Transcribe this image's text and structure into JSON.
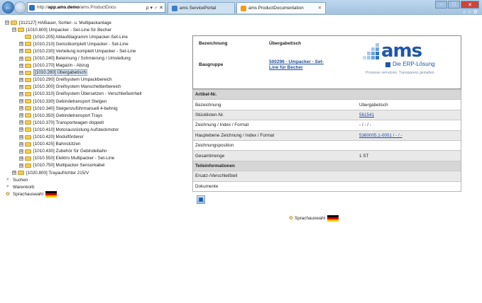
{
  "browser": {
    "address_prefix": "http://",
    "address_host": "app.ams.demo",
    "address_path": "/ams.ProductDocu",
    "address_controls": "ρ ▾ ♂ ✕",
    "tabs": [
      {
        "label": "ams ServicePortal"
      },
      {
        "label": "ams ProductDocumentation",
        "close": "✕"
      }
    ],
    "window_buttons": {
      "minimize": "–",
      "maximize": "□",
      "close": "✕"
    },
    "tool_icons": "⌂ ☆ ⚙"
  },
  "tree": {
    "nodes": [
      {
        "expander": "⊟",
        "label": "[312127] HABauer, Sortier- u. Multipackanlage",
        "indent": 0
      },
      {
        "expander": "⊟",
        "label": "[1010.800] Umpacker - Set-Line für Becher",
        "indent": 1
      },
      {
        "expander": "",
        "label": "[1010.205] Ablaufdiagramm Umpacker-Set-Line",
        "indent": 2
      },
      {
        "expander": "⊞",
        "label": "[1010.210] Gerüstkomplett Umpacker - Set-Line",
        "indent": 2
      },
      {
        "expander": "⊞",
        "label": "[1010.230] Verteilung komplett Umpacker - Set-Line",
        "indent": 2
      },
      {
        "expander": "⊞",
        "label": "[1010.240] Beleimung / Schmierung / Umstellung",
        "indent": 2
      },
      {
        "expander": "⊞",
        "label": "[1010.270] Magazin - Abzug",
        "indent": 2
      },
      {
        "expander": "⊞",
        "label": "[1010.280] Übergabetisch",
        "indent": 2,
        "selected": true
      },
      {
        "expander": "⊞",
        "label": "[1010.290] Greifsystem Umpackbereich",
        "indent": 2
      },
      {
        "expander": "⊞",
        "label": "[1010.300] Greifsystem Manschettierbereich",
        "indent": 2
      },
      {
        "expander": "⊞",
        "label": "[1010.310] Greifsystem Übersetzen - Verschließeinheit",
        "indent": 2
      },
      {
        "expander": "⊞",
        "label": "[1010.330] Gebindetransport Steigen",
        "indent": 2
      },
      {
        "expander": "⊞",
        "label": "[1010.340] Steigenzuführmanuell 4-behnig",
        "indent": 2
      },
      {
        "expander": "⊞",
        "label": "[1010.350] Gebindetransport Trays",
        "indent": 2
      },
      {
        "expander": "⊞",
        "label": "[1010.370] Transportwagen doppelt",
        "indent": 2
      },
      {
        "expander": "⊞",
        "label": "[1010.410] Motorausrüstung Aufsteckmotor",
        "indent": 2
      },
      {
        "expander": "⊞",
        "label": "[1010.420] Modulförderer",
        "indent": 2
      },
      {
        "expander": "⊞",
        "label": "[1010.425] Bahnstützen",
        "indent": 2
      },
      {
        "expander": "⊞",
        "label": "[1010.430] Zubehör für Gebindebahn",
        "indent": 2
      },
      {
        "expander": "⊞",
        "label": "[1010.550] Elektro Multipacker - Set-Line",
        "indent": 2
      },
      {
        "expander": "⊞",
        "label": "[1010.750] Multipacker Sensorkabel",
        "indent": 2
      },
      {
        "expander": "⊞",
        "label": "[1020.800] Trayaufrichter 215/V",
        "indent": 1
      }
    ],
    "search_label": "Suchen",
    "cart_label": "Warenkorb",
    "language_label": "Sprachauswahl"
  },
  "header": {
    "bezeichnung_label": "Bezeichnung",
    "bezeichnung_value": "Übergabetisch",
    "baugruppe_label": "Baugruppe",
    "baugruppe_value": "500296 - Umpacker - Set-Line für Becher"
  },
  "logo": {
    "word": "ams",
    "tagline": "Die ERP-Lösung",
    "slogan": "Prozesse vernetzen. Transparenz gestalten."
  },
  "table": {
    "rows": [
      {
        "label": "Artikel-Nr.",
        "value": "",
        "style": "head"
      },
      {
        "label": "Bezeichnung",
        "value": "Übergabetisch",
        "style": "plain"
      },
      {
        "label": "Stücklisten-Nr.",
        "value": "561541",
        "style": "gray",
        "link": true
      },
      {
        "label": "Zeichnung / Index / Format",
        "value": "- / - / -",
        "style": "plain"
      },
      {
        "label": "Hauptebene Zeichnung / Index / Format",
        "value": "5360005.1-0001 / - / -",
        "style": "gray",
        "link": true
      },
      {
        "label": "Zeichnungsposition",
        "value": "",
        "style": "plain"
      },
      {
        "label": "Gesamtmenge",
        "value": "1 ST",
        "style": "gray"
      },
      {
        "label": "Teileinformationen",
        "value": "",
        "style": "head"
      },
      {
        "label": "Ersatz-/Verschleißteil",
        "value": "",
        "style": "gray"
      },
      {
        "label": "Dokumente",
        "value": "",
        "style": "plain"
      }
    ]
  },
  "content": {
    "language_label": "Sprachauswahl",
    "export_icon": "▣"
  }
}
